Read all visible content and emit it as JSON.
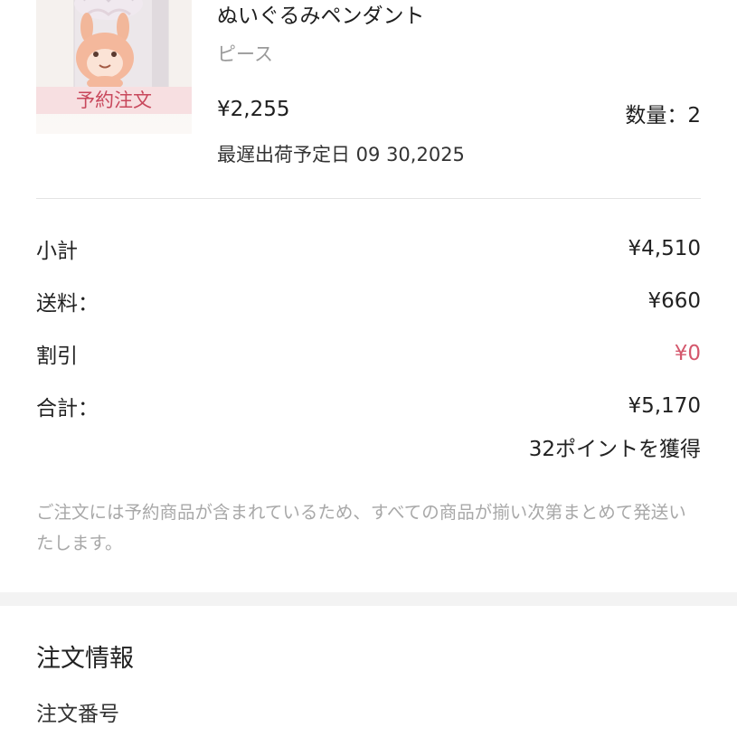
{
  "product": {
    "name": "ぬいぐるみペンダント",
    "unit": "ピース",
    "badge": "予約注文",
    "price": "¥2,255",
    "quantity": "数量：2",
    "ship_date": "最遅出荷予定日 09 30,2025",
    "image_icon": "plush-pendant-box-image"
  },
  "summary": {
    "subtotal_label": "小計",
    "subtotal_value": "¥4,510",
    "shipping_label": "送料：",
    "shipping_value": "¥660",
    "discount_label": "割引",
    "discount_value": "¥0",
    "total_label": "合計：",
    "total_value": "¥5,170",
    "points": "32ポイントを獲得"
  },
  "note": "ご注文には予約商品が含まれているため、すべての商品が揃い次第まとめて発送いたします。",
  "order_info": {
    "title": "注文情報",
    "order_number_label": "注文番号"
  },
  "colors": {
    "accent": "#d4576c",
    "badge_bg": "#f7dfe1",
    "muted_text": "#a8a8a8",
    "section_gap": "#f3f3f3"
  }
}
